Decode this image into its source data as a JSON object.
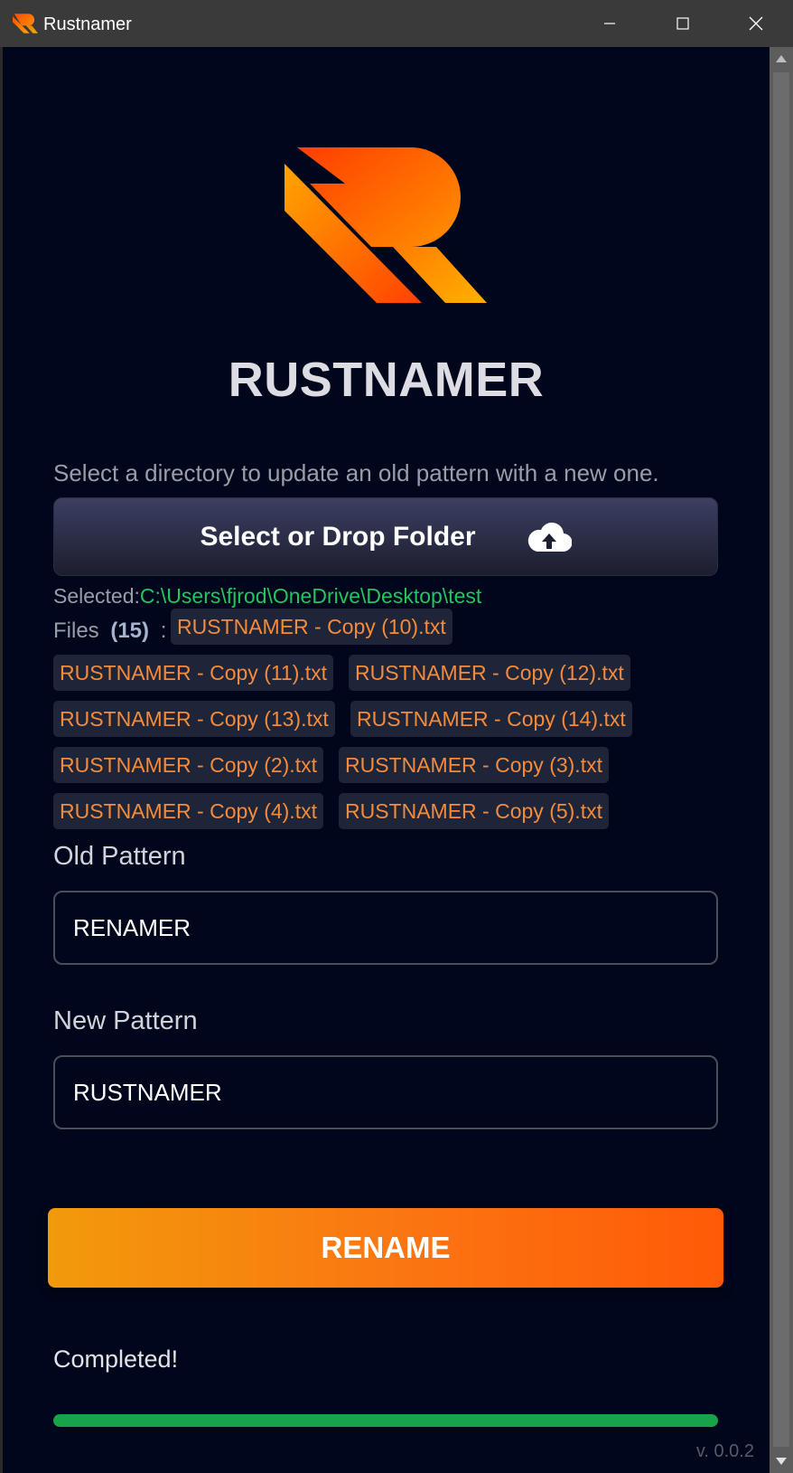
{
  "window": {
    "title": "Rustnamer",
    "app_icon": "rustnamer-logo-icon",
    "controls": [
      "minimize-icon",
      "maximize-icon",
      "close-icon"
    ]
  },
  "header": {
    "logo": "rustnamer-logo",
    "brand": "RUSTNAMER"
  },
  "main": {
    "instructions": "Select a directory to update an old pattern with a new one.",
    "drop_zone": {
      "label": "Select or Drop Folder",
      "icon": "cloud-upload-icon"
    },
    "selected": {
      "label": "Selected:",
      "path": "C:\\Users\\fjrod\\OneDrive\\Desktop\\test"
    },
    "files": {
      "label": "Files",
      "count": "(15)",
      "separator": ":",
      "items": [
        "RUSTNAMER - Copy (10).txt",
        "RUSTNAMER - Copy (11).txt",
        "RUSTNAMER - Copy (12).txt",
        "RUSTNAMER - Copy (13).txt",
        "RUSTNAMER - Copy (14).txt",
        "RUSTNAMER - Copy (2).txt",
        "RUSTNAMER - Copy (3).txt",
        "RUSTNAMER - Copy (4).txt",
        "RUSTNAMER - Copy (5).txt"
      ]
    },
    "old_pattern": {
      "label": "Old Pattern",
      "value": "RENAMER"
    },
    "new_pattern": {
      "label": "New Pattern",
      "value": "RUSTNAMER"
    },
    "rename_button": "RENAME",
    "status": "Completed!",
    "progress": 1.0,
    "version": "v. 0.0.2"
  },
  "colors": {
    "background": "#00061c",
    "accent_orange": "#fb7412",
    "path_green": "#22c55e",
    "progress_green": "#16a34a",
    "chip_text": "#f58a3b"
  }
}
